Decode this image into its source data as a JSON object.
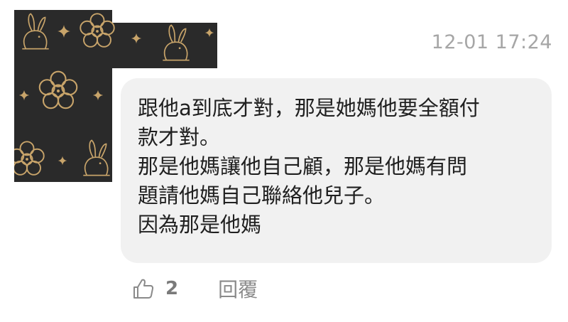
{
  "comment": {
    "timestamp": "12-01 17:24",
    "text": "跟他a到底才對，那是她媽他要全額付\n款才對。\n那是他媽讓他自己顧，那是他媽有問\n題請他媽自己聯絡他兒子。\n因為那是他媽",
    "like_count": "2",
    "reply_label": "回覆"
  },
  "avatar": {
    "description_icon": "mid-autumn-rabbit-mooncake-pattern",
    "colors": {
      "background": "#2a2a2a",
      "line": "#c8a46a"
    }
  },
  "icons": {
    "like": "thumbs-up-icon"
  },
  "colors": {
    "bubble": "#f1f1f1",
    "text": "#202020",
    "timestamp": "#a6a6a6",
    "action": "#7a7a7a"
  }
}
